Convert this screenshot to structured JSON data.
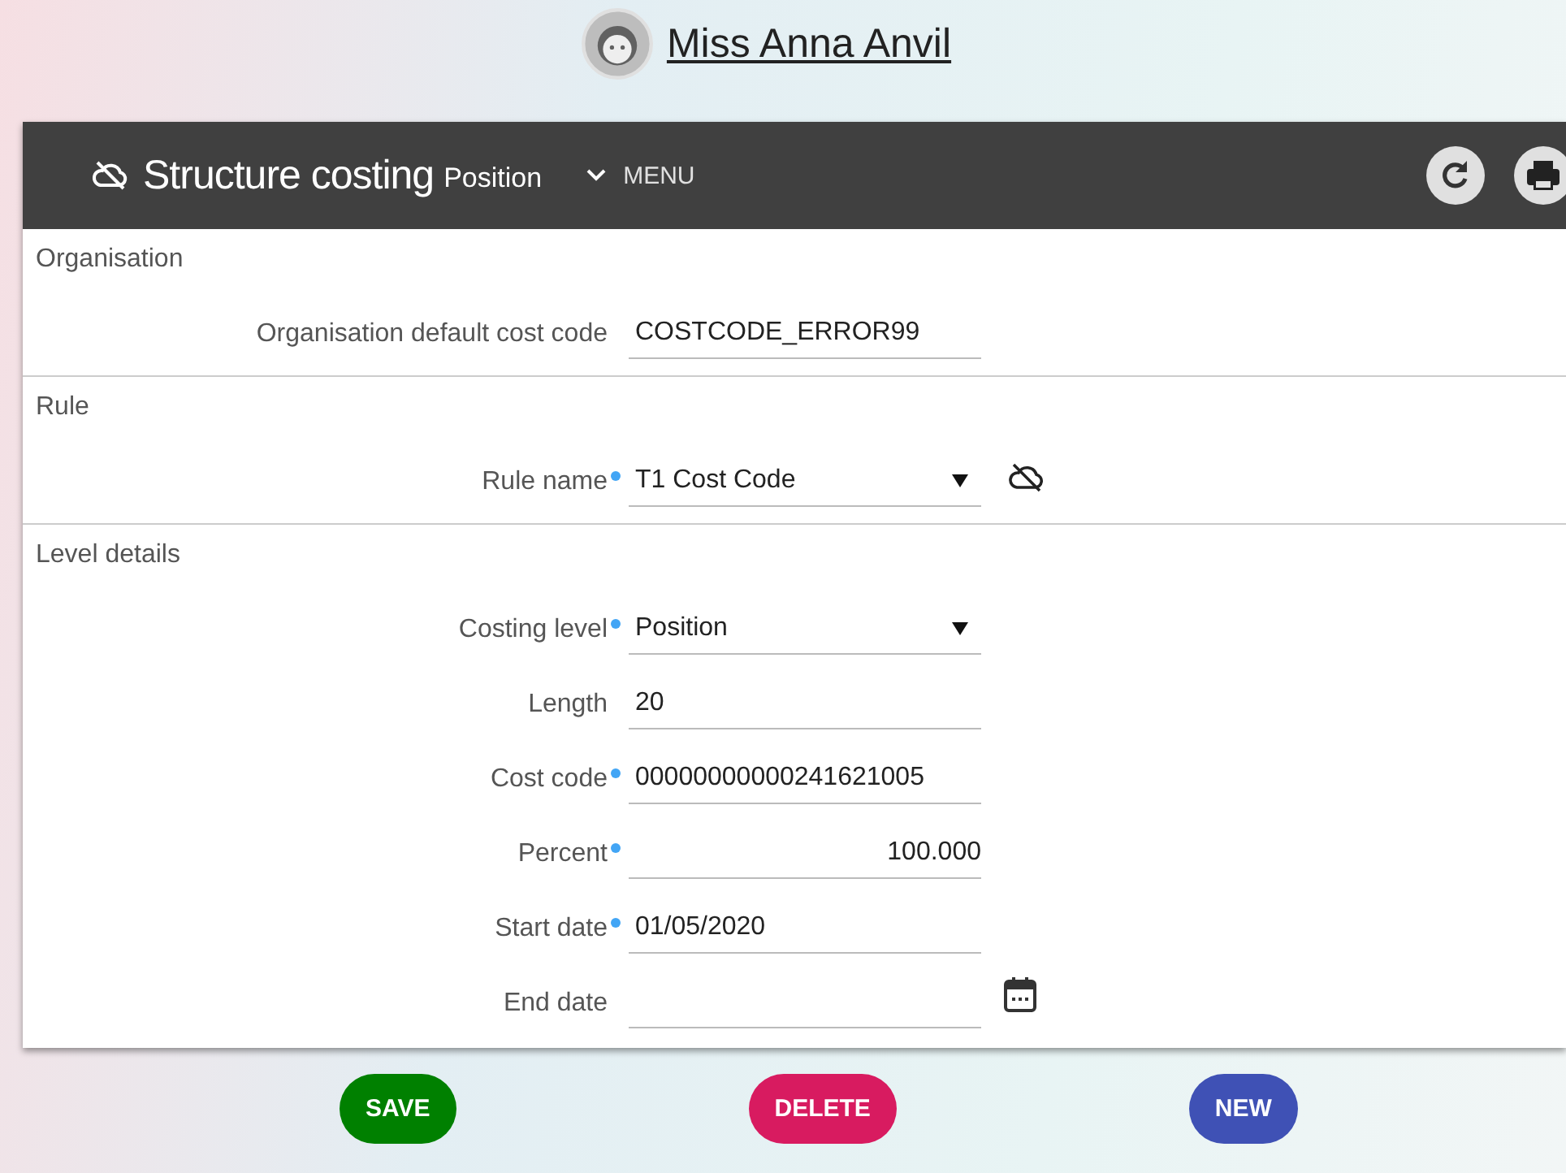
{
  "user": {
    "name": "Miss Anna Anvil"
  },
  "header": {
    "title": "Structure costing",
    "subtitle": "Position",
    "menu": "MENU"
  },
  "sections": [
    {
      "title": "Organisation",
      "fields": [
        {
          "label": "Organisation default cost code",
          "kind": "text",
          "required": false,
          "value": "COSTCODE_ERROR99"
        }
      ]
    },
    {
      "title": "Rule",
      "fields": [
        {
          "label": "Rule name",
          "kind": "select-linked",
          "required": true,
          "value": "T1 Cost Code"
        }
      ]
    },
    {
      "title": "Level details",
      "fields": [
        {
          "label": "Costing level",
          "kind": "select",
          "required": true,
          "value": "Position"
        },
        {
          "label": "Length",
          "kind": "text",
          "required": false,
          "value": "20"
        },
        {
          "label": "Cost code",
          "kind": "text",
          "required": true,
          "value": "00000000000241621005"
        },
        {
          "label": "Percent",
          "kind": "number",
          "required": true,
          "value": "100.000"
        },
        {
          "label": "Start date",
          "kind": "text",
          "required": true,
          "value": "01/05/2020"
        },
        {
          "label": "End date",
          "kind": "date",
          "required": false
        }
      ]
    }
  ],
  "buttons": [
    {
      "label": "SAVE",
      "color": "#008000"
    },
    {
      "label": "DELETE",
      "color": "#d81b60"
    },
    {
      "label": "NEW",
      "color": "#3f51b5"
    }
  ]
}
